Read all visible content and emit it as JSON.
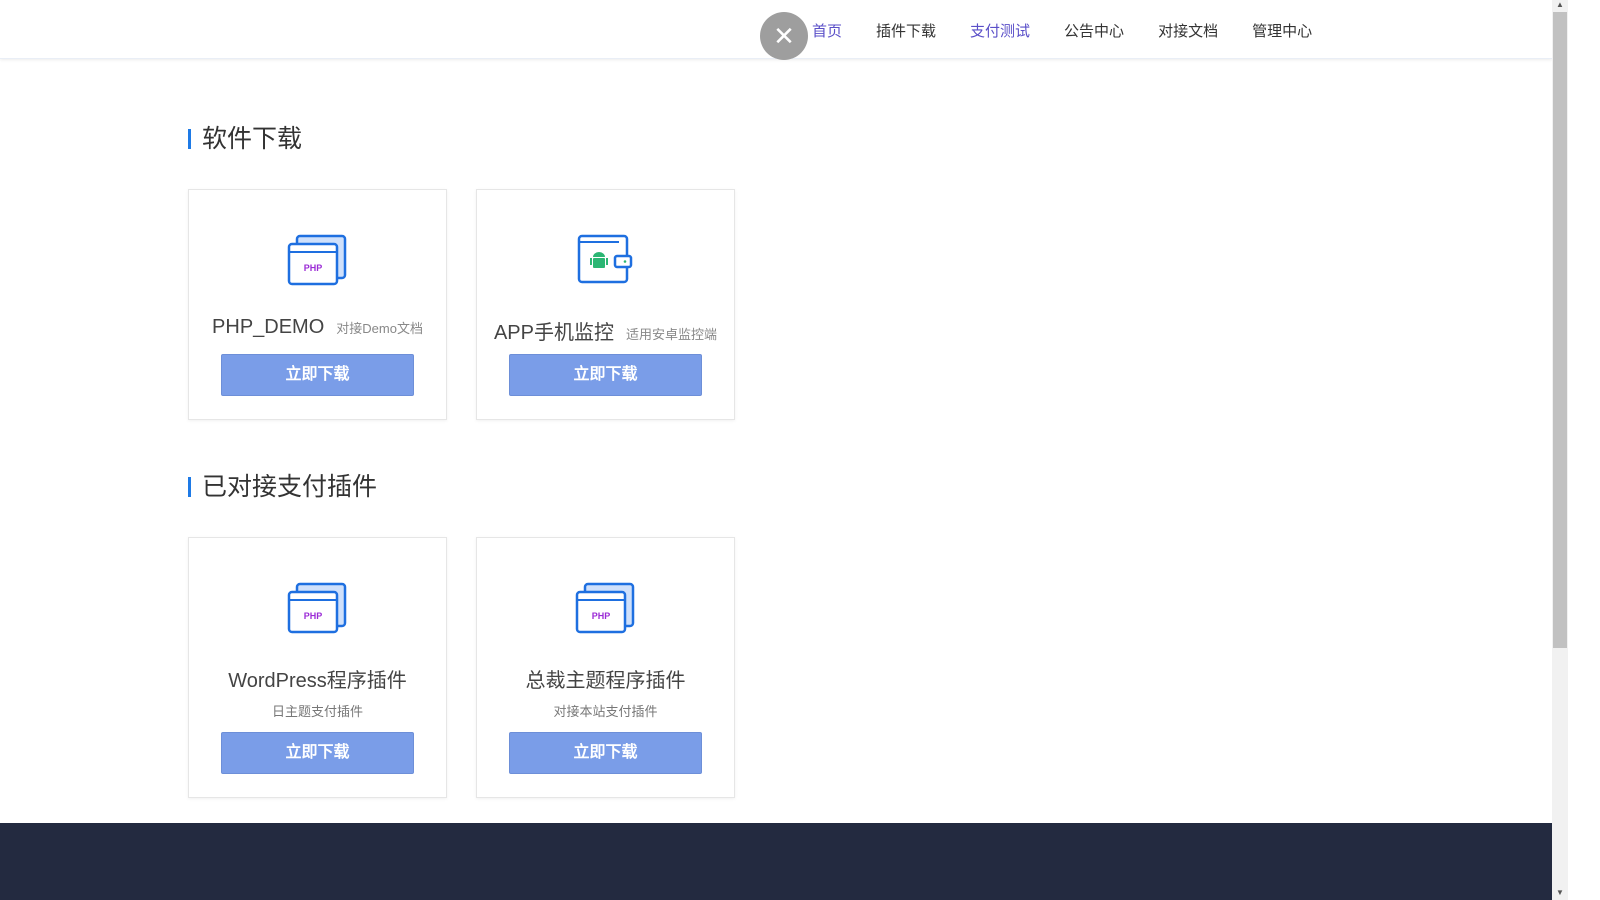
{
  "nav": {
    "close": "✕",
    "items": [
      "首页",
      "插件下载",
      "支付测试",
      "公告中心",
      "对接文档",
      "管理中心"
    ]
  },
  "sections": [
    {
      "title": "软件下载",
      "cards": [
        {
          "name": "PHP_DEMO",
          "note": "对接Demo文档",
          "button": "立即下载",
          "icon": "php-window-icon"
        },
        {
          "name": "APP手机监控",
          "note": "适用安卓监控端",
          "button": "立即下载",
          "icon": "android-wallet-icon"
        }
      ]
    },
    {
      "title": "已对接支付插件",
      "cards": [
        {
          "name": "WordPress程序插件",
          "sub": "日主题支付插件",
          "button": "立即下载",
          "icon": "php-window-icon"
        },
        {
          "name": "总裁主题程序插件",
          "sub": "对接本站支付插件",
          "button": "立即下载",
          "icon": "php-window-icon"
        }
      ]
    }
  ],
  "colors": {
    "accent": "#1e7ae6",
    "button": "#7a9de8",
    "footer": "#232a40"
  }
}
